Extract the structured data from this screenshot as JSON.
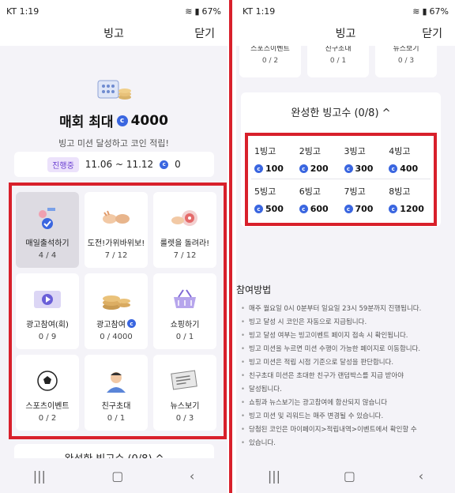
{
  "status": {
    "time": "1:19",
    "carrier": "KT",
    "battery": "67%"
  },
  "appbar": {
    "title": "빙고",
    "close": "닫기"
  },
  "hero": {
    "title": "매회 최대",
    "amount": "4000",
    "subtitle": "빙고 미션 달성하고 코인 적립!"
  },
  "period": {
    "badge": "진행중",
    "range": "11.06 ~ 11.12",
    "coins": "0"
  },
  "missions": [
    {
      "label": "매일출석하기",
      "count": "4 / 4",
      "icon": "calendar-check-icon",
      "done": true
    },
    {
      "label": "도전!가위바위보!",
      "count": "7 / 12",
      "icon": "rock-paper-scissors-icon",
      "done": false
    },
    {
      "label": "룰렛을 돌려라!",
      "count": "7 / 12",
      "icon": "roulette-target-icon",
      "done": false
    },
    {
      "label": "광고참여(회)",
      "count": "0 / 9",
      "icon": "video-play-icon",
      "done": false
    },
    {
      "label": "광고참여",
      "count": "0 / 4000",
      "icon": "coin-stack-icon",
      "done": false
    },
    {
      "label": "쇼핑하기",
      "count": "0 / 1",
      "icon": "shopping-basket-icon",
      "done": false
    },
    {
      "label": "스포츠이벤트",
      "count": "0 / 2",
      "icon": "soccer-ball-icon",
      "done": false
    },
    {
      "label": "친구초대",
      "count": "0 / 1",
      "icon": "friend-avatar-icon",
      "done": false
    },
    {
      "label": "뉴스보기",
      "count": "0 / 3",
      "icon": "newspaper-icon",
      "done": false
    }
  ],
  "completed": {
    "title": "완성한 빙고수 (0/8)"
  },
  "bingo_rewards": [
    {
      "label": "1빙고",
      "value": "100"
    },
    {
      "label": "2빙고",
      "value": "200"
    },
    {
      "label": "3빙고",
      "value": "300"
    },
    {
      "label": "4빙고",
      "value": "400"
    },
    {
      "label": "5빙고",
      "value": "500"
    },
    {
      "label": "6빙고",
      "value": "600"
    },
    {
      "label": "7빙고",
      "value": "700"
    },
    {
      "label": "8빙고",
      "value": "1200"
    }
  ],
  "participation": {
    "title": "참여방법",
    "items": [
      "매주 월요일 0시 0분부터 일요일 23시 59분까지 진행됩니다.",
      "빙고 달성 시 코인은 자동으로 지급됩니다.",
      "빙고 달성 여부는 빙고이벤트 페이지 접속 시 확인됩니다.",
      "빙고 미션을 누르면 미션 수행이 가능한 페이지로 이동합니다.",
      "빙고 미션은 적립 시점 기준으로 달성을 판단합니다.",
      "친구초대 미션은 초대한 친구가 랜덤박스를 지급 받아야",
      "달성됩니다.",
      "쇼핑과 뉴스보기는 광고참여에 합산되지 않습니다",
      "빙고 미션 및 리워드는 매주 변경될 수 있습니다.",
      "당첨된 코인은 마이페이지>적립내역>이벤트에서 확인할 수",
      "있습니다."
    ]
  },
  "colors": {
    "accent": "#3a66e0",
    "highlight": "#d8202b",
    "badge": "#6a3fd1"
  }
}
